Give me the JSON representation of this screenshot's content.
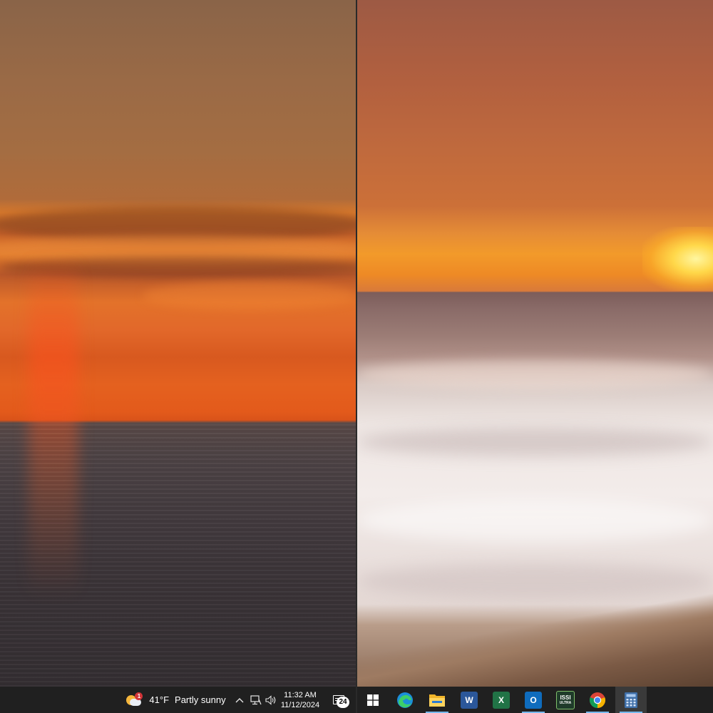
{
  "taskbar_left": {
    "weather": {
      "badge": "1",
      "temperature": "41°F",
      "condition": "Partly sunny"
    },
    "tray": {
      "chevron": "^",
      "network_icon": "network-icon",
      "volume_icon": "volume-icon"
    },
    "clock": {
      "time": "11:32 AM",
      "date": "11/12/2024"
    },
    "notifications": {
      "count": "24"
    }
  },
  "taskbar_right": {
    "apps": [
      {
        "name": "start",
        "icon": "windows-logo-icon"
      },
      {
        "name": "edge",
        "icon": "edge-icon"
      },
      {
        "name": "file-explorer",
        "icon": "folder-icon"
      },
      {
        "name": "word",
        "icon": "word-icon",
        "label": "W"
      },
      {
        "name": "excel",
        "icon": "excel-icon",
        "label": "X"
      },
      {
        "name": "outlook",
        "icon": "outlook-icon",
        "label": "O"
      },
      {
        "name": "issi-ultra",
        "icon": "issi-ultra-icon",
        "label": "ISSI",
        "sublabel": "ULTRA"
      },
      {
        "name": "chrome",
        "icon": "chrome-icon"
      },
      {
        "name": "calculator",
        "icon": "calculator-icon"
      }
    ]
  },
  "colors": {
    "taskbar": "#202020",
    "active_indicator": "#76b9ed",
    "word": "#2b579a",
    "excel": "#217346",
    "outlook": "#0f6cbd"
  }
}
